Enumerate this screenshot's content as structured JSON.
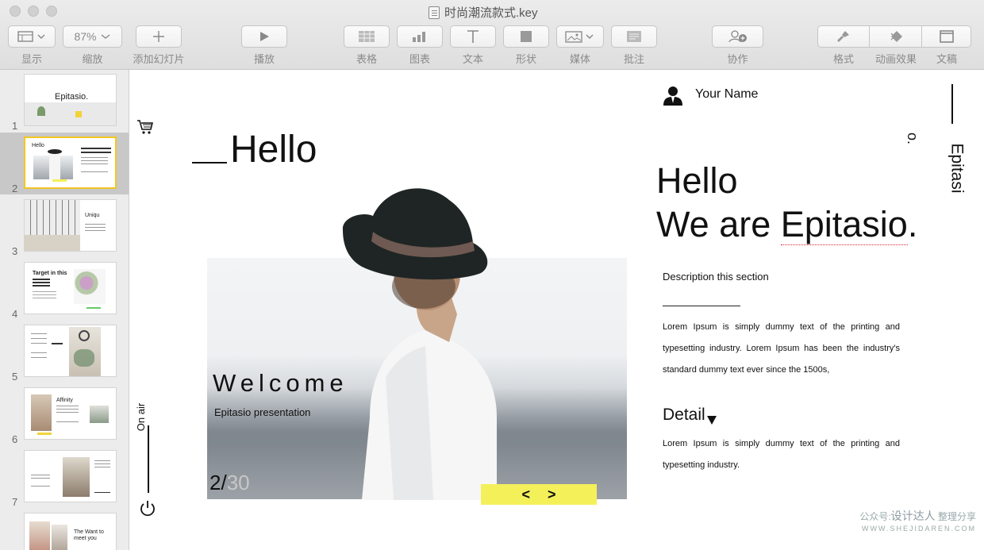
{
  "window": {
    "title": "时尚潮流款式.key"
  },
  "toolbar": {
    "view_label": "显示",
    "zoom_value": "87%",
    "zoom_label": "缩放",
    "add_slide_label": "添加幻灯片",
    "play_label": "播放",
    "table_label": "表格",
    "chart_label": "图表",
    "text_label": "文本",
    "shape_label": "形状",
    "media_label": "媒体",
    "comment_label": "批注",
    "collab_label": "协作",
    "format_label": "格式",
    "animate_label": "动画效果",
    "document_label": "文稿"
  },
  "sidebar": {
    "slides": [
      {
        "number": "1",
        "title": "Epitasio."
      },
      {
        "number": "2",
        "title": "Hello",
        "selected": true
      },
      {
        "number": "3",
        "title": "Uniqu"
      },
      {
        "number": "4",
        "title": "Target in this"
      },
      {
        "number": "5",
        "title": ""
      },
      {
        "number": "6",
        "title": "Affinity"
      },
      {
        "number": "7",
        "title": ""
      },
      {
        "number": "8",
        "title": "The Want to meet you"
      }
    ]
  },
  "slide": {
    "hello_small": "Hello",
    "welcome": "Welcome",
    "subtitle": "Epitasio presentation",
    "page_current": "2/",
    "page_total": "30",
    "on_air": "On air",
    "your_name": "Your Name",
    "headline_line1": "Hello",
    "headline_line2_a": "We are ",
    "headline_line2_b": "Epitasio",
    "headline_line2_c": ".",
    "vertical_brand": "Epitasi",
    "vertical_small": "o.",
    "description_heading": "Description this section",
    "paragraph1": "Lorem Ipsum is simply dummy text of the printing and typesetting industry. Lorem Ipsum has been the industry's standard dummy text ever since the 1500s,",
    "detail_heading": "Detail",
    "paragraph2": "Lorem Ipsum is simply dummy text of the printing and typesetting industry."
  },
  "watermark": {
    "prefix": "公众号:",
    "brand": "设计达人",
    "suffix": " 整理分享",
    "url": "WWW.SHEJIDAREN.COM"
  },
  "colors": {
    "accent_yellow": "#f4f05a",
    "selection": "#f3c623"
  }
}
